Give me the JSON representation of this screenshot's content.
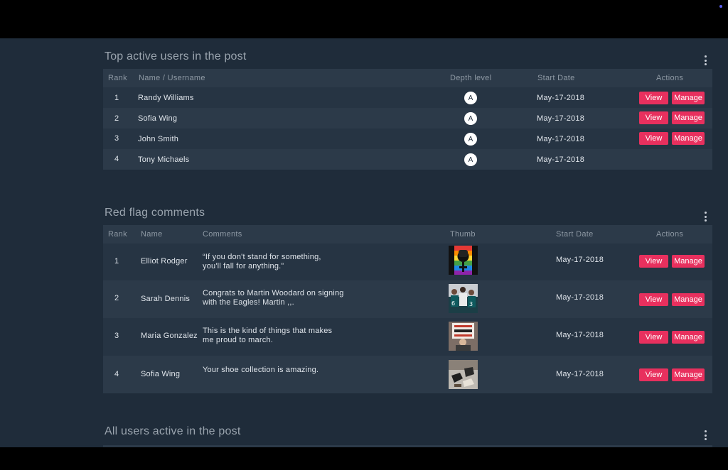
{
  "sections": {
    "top_users": {
      "title": "Top active users in the post",
      "columns": {
        "rank": "Rank",
        "name": "Name / Username",
        "depth": "Depth level",
        "date": "Start Date",
        "actions": "Actions"
      },
      "rows": [
        {
          "rank": "1",
          "name": "Randy Williams",
          "depth": "A",
          "date": "May-17-2018",
          "view": "View",
          "manage": "Manage"
        },
        {
          "rank": "2",
          "name": "Sofia Wing",
          "depth": "A",
          "date": "May-17-2018",
          "view": "View",
          "manage": "Manage"
        },
        {
          "rank": "3",
          "name": "John Smith",
          "depth": "A",
          "date": "May-17-2018",
          "view": "View",
          "manage": "Manage"
        },
        {
          "rank": "4",
          "name": "Tony Michaels",
          "depth": "A",
          "date": "May-17-2018"
        }
      ]
    },
    "red_flag": {
      "title": "Red flag comments",
      "columns": {
        "rank": "Rank",
        "name": "Name",
        "comments": "Comments",
        "thumb": "Thumb",
        "date": "Start Date",
        "actions": "Actions"
      },
      "rows": [
        {
          "rank": "1",
          "name": "Elliot Rodger",
          "comment_l1": "“If you don't stand for something,",
          "comment_l2": "you'll fall for anything.”",
          "thumb": "rainbow-fist-image",
          "date": "May-17-2018",
          "view": "View",
          "manage": "Manage"
        },
        {
          "rank": "2",
          "name": "Sarah Dennis",
          "comment_l1": "Congrats to Martin Woodard on signing",
          "comment_l2": "with the Eagles! Martin ,,.",
          "thumb": "football-players-image",
          "date": "May-17-2018",
          "view": "View",
          "manage": "Manage"
        },
        {
          "rank": "3",
          "name": "Maria Gonzalez",
          "comment_l1": "This is the kind of things that makes",
          "comment_l2": "me proud to march.",
          "thumb": "protest-sign-image",
          "date": "May-17-2018",
          "view": "View",
          "manage": "Manage"
        },
        {
          "rank": "4",
          "name": "Sofia Wing",
          "comment_l1": "Your shoe collection is amazing.",
          "comment_l2": "",
          "thumb": "shoes-image",
          "date": "May-17-2018",
          "view": "View",
          "manage": "Manage"
        }
      ]
    },
    "all_users": {
      "title": "All users active in the post"
    }
  },
  "colors": {
    "accent": "#e8305e",
    "background": "#1f2c3a",
    "row_dark": "#263443",
    "row_light": "#2c3a49"
  }
}
